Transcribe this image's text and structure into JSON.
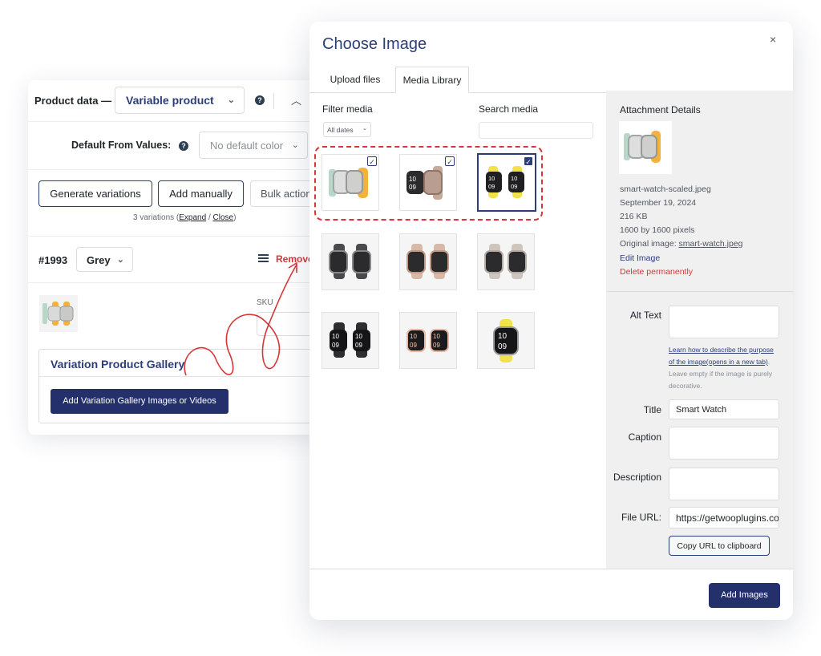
{
  "product_data": {
    "title": "Product data —",
    "type_select": "Variable product",
    "default_label": "Default From Values:",
    "default_select": "No default color",
    "buttons": {
      "generate": "Generate variations",
      "manual": "Add manually",
      "bulk": "Bulk actions"
    },
    "variations_summary": {
      "prefix": "3 variations (",
      "expand": "Expand",
      "divider": " / ",
      "close": "Close",
      "suffix": ")"
    },
    "variation": {
      "id": "#1993",
      "color": "Grey",
      "remove": "Remove",
      "sku_label": "SKU"
    },
    "gallery": {
      "title": "Variation Product Gallery",
      "add_button": "Add Variation Gallery Images or Videos"
    }
  },
  "modal": {
    "title": "Choose Image",
    "close_glyph": "×",
    "tabs": [
      "Upload files",
      "Media Library"
    ],
    "filter_label": "Filter media",
    "filter_select": "All dates",
    "search_label": "Search media",
    "attachment": {
      "heading": "Attachment Details",
      "filename": "smart-watch-scaled.jpeg",
      "date": "September 19, 2024",
      "size": "216 KB",
      "dimensions": "1600 by 1600 pixels",
      "original_prefix": "Original image: ",
      "original_link": "smart-watch.jpeg",
      "edit": "Edit Image",
      "delete": "Delete permanently"
    },
    "fields": {
      "alt_label": "Alt Text",
      "alt_help_link": "Learn how to describe the purpose of the image(opens in a new tab)",
      "alt_help_text": ". Leave empty if the image is purely decorative.",
      "title_label": "Title",
      "title_value": "Smart Watch",
      "caption_label": "Caption",
      "description_label": "Description",
      "url_label": "File URL:",
      "url_value": "https://getwooplugins.com",
      "copy_button": "Copy URL to clipboard"
    },
    "add_button": "Add Images",
    "check_glyph": "✓"
  },
  "colors": {
    "accent": "#23306b",
    "link": "#2c3e78",
    "danger": "#d63638"
  }
}
